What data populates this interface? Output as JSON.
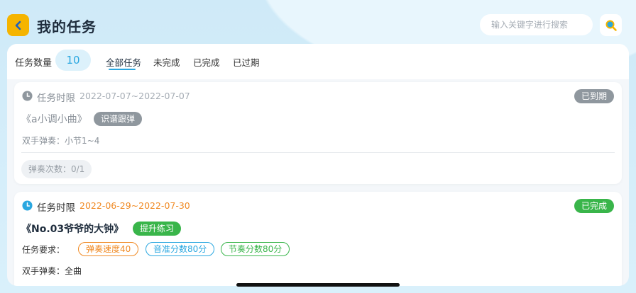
{
  "header": {
    "title": "我的任务",
    "search_placeholder": "输入关键字进行搜索"
  },
  "filter": {
    "count_label": "任务数量",
    "count_value": "10",
    "tabs": [
      {
        "label": "全部任务",
        "active": true
      },
      {
        "label": "未完成",
        "active": false
      },
      {
        "label": "已完成",
        "active": false
      },
      {
        "label": "已过期",
        "active": false
      }
    ]
  },
  "tasks": [
    {
      "deadline_label": "任务时限",
      "deadline_range": "2022-07-07~2022-07-07",
      "status": "已到期",
      "status_color": "#8f979e",
      "song": "《a小调小曲》",
      "tag": "识谱跟弹",
      "tag_color": "#8f979e",
      "detail": "双手弹奏：小节1~4",
      "play_count": "弹奏次数：0/1"
    },
    {
      "deadline_label": "任务时限",
      "deadline_range": "2022-06-29~2022-07-30",
      "status": "已完成",
      "status_color": "#39b54a",
      "song": "《No.03爷爷的大钟》",
      "tag": "提升练习",
      "tag_color": "#39b54a",
      "requirements_label": "任务要求：",
      "requirements": [
        {
          "label": "弹奏速度40",
          "color": "#f08a24"
        },
        {
          "label": "音准分数80分",
          "color": "#2aa7e0"
        },
        {
          "label": "节奏分数80分",
          "color": "#39b54a"
        }
      ],
      "detail": "双手弹奏：全曲"
    }
  ]
}
